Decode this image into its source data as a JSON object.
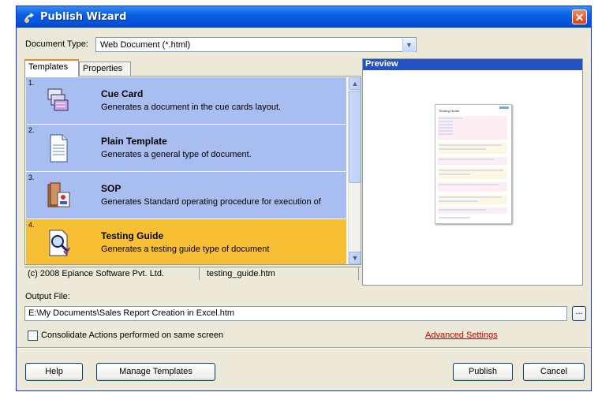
{
  "window": {
    "title": "Publish Wizard",
    "close_label": "✕"
  },
  "document_type": {
    "label": "Document Type:",
    "value": "Web Document (*.html)"
  },
  "tabs": [
    {
      "label": "Templates",
      "active": true
    },
    {
      "label": "Properties",
      "active": false
    }
  ],
  "templates": [
    {
      "num": "1.",
      "name": "Cue Card",
      "desc": "Generates a document in the cue cards layout.",
      "icon": "cue-card-icon"
    },
    {
      "num": "2.",
      "name": "Plain Template",
      "desc": "Generates a general type of document.",
      "icon": "document-icon"
    },
    {
      "num": "3.",
      "name": "SOP",
      "desc": "Generates Standard operating procedure for execution of",
      "icon": "sop-icon"
    },
    {
      "num": "4.",
      "name": "Testing Guide",
      "desc": "Generates a testing guide type of document",
      "icon": "testing-guide-icon"
    }
  ],
  "status": {
    "copyright": "(c) 2008 Epiance Software Pvt. Ltd.",
    "file": "testing_guide.htm"
  },
  "preview": {
    "title": "Preview",
    "doc_title": "Testing Guide"
  },
  "output": {
    "label": "Output File:",
    "value": "E:\\My Documents\\Sales Report Creation in Excel.htm",
    "browse_label": "..."
  },
  "consolidate": {
    "label": "Consolidate Actions performed on same screen",
    "checked": false
  },
  "advanced_settings": "Advanced Settings",
  "buttons": {
    "help": "Help",
    "manage": "Manage Templates",
    "publish": "Publish",
    "cancel": "Cancel"
  },
  "colors": {
    "title_bar": "#0450d8",
    "list_item": "#a8bef0",
    "selected_item": "#f7c034",
    "preview_header": "#2352c4",
    "link": "#cc0000"
  }
}
